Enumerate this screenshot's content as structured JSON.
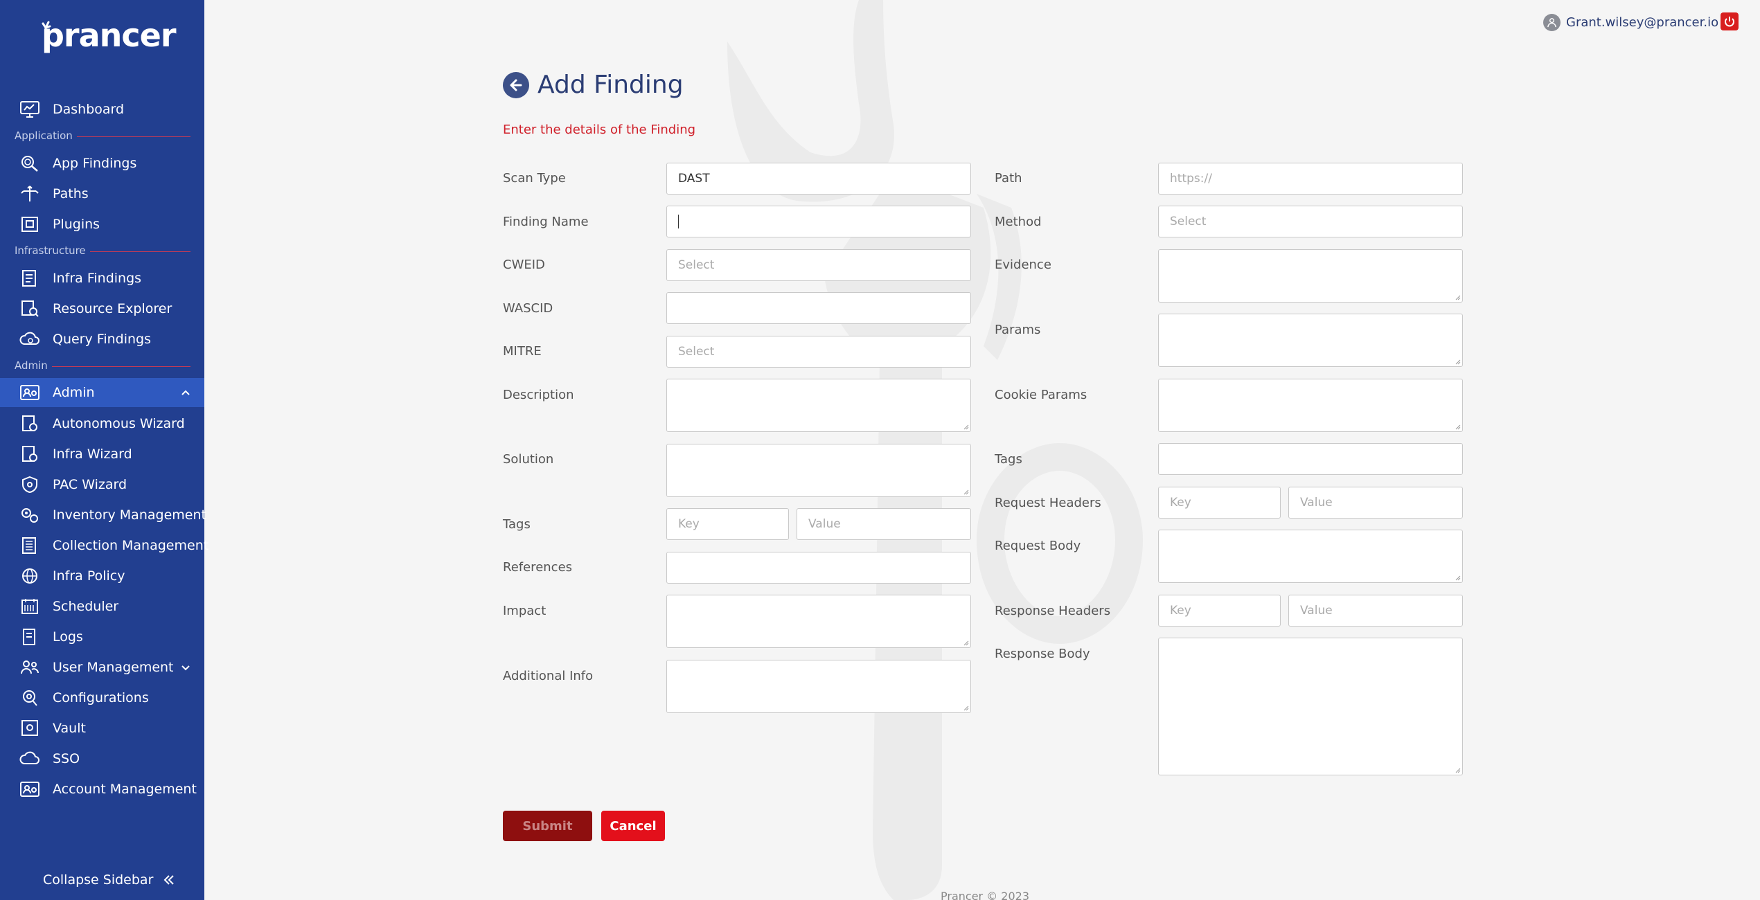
{
  "brand": {
    "name": "prancer"
  },
  "sidebar": {
    "dashboard": "Dashboard",
    "sections": {
      "application": "Application",
      "infrastructure": "Infrastructure",
      "admin": "Admin"
    },
    "application_items": [
      "App Findings",
      "Paths",
      "Plugins"
    ],
    "infrastructure_items": [
      "Infra Findings",
      "Resource Explorer",
      "Query Findings"
    ],
    "admin_group": "Admin",
    "admin_items": [
      "Autonomous Wizard",
      "Infra Wizard",
      "PAC Wizard",
      "Inventory Management",
      "Collection Management",
      "Infra Policy",
      "Scheduler",
      "Logs",
      "User Management",
      "Configurations",
      "Vault",
      "SSO",
      "Account Management"
    ],
    "collapse": "Collapse Sidebar"
  },
  "user": {
    "email": "Grant.wilsey@prancer.io"
  },
  "page": {
    "title": "Add Finding",
    "subtitle": "Enter the details of the Finding"
  },
  "form": {
    "left": {
      "scan_type": {
        "label": "Scan Type",
        "value": "DAST"
      },
      "finding_name": {
        "label": "Finding Name",
        "value": ""
      },
      "cweid": {
        "label": "CWEID",
        "placeholder": "Select"
      },
      "wascid": {
        "label": "WASCID",
        "value": ""
      },
      "mitre": {
        "label": "MITRE",
        "placeholder": "Select"
      },
      "description": {
        "label": "Description"
      },
      "solution": {
        "label": "Solution"
      },
      "tags": {
        "label": "Tags",
        "key_placeholder": "Key",
        "value_placeholder": "Value"
      },
      "references": {
        "label": "References"
      },
      "impact": {
        "label": "Impact"
      },
      "additional_info": {
        "label": "Additional Info"
      }
    },
    "right": {
      "path": {
        "label": "Path",
        "placeholder": "https://"
      },
      "method": {
        "label": "Method",
        "placeholder": "Select"
      },
      "evidence": {
        "label": "Evidence"
      },
      "params": {
        "label": "Params"
      },
      "cookie_params": {
        "label": "Cookie Params"
      },
      "tags": {
        "label": "Tags"
      },
      "request_headers": {
        "label": "Request Headers",
        "key_placeholder": "Key",
        "value_placeholder": "Value"
      },
      "request_body": {
        "label": "Request Body"
      },
      "response_headers": {
        "label": "Response Headers",
        "key_placeholder": "Key",
        "value_placeholder": "Value"
      },
      "response_body": {
        "label": "Response Body"
      }
    },
    "submit": "Submit",
    "cancel": "Cancel"
  },
  "footer": "Prancer © 2023",
  "colors": {
    "sidebar": "#223f90",
    "active": "#2f59bf",
    "accent_red": "#e3101b",
    "submit": "#8e0f0f",
    "title": "#2b3d74"
  }
}
